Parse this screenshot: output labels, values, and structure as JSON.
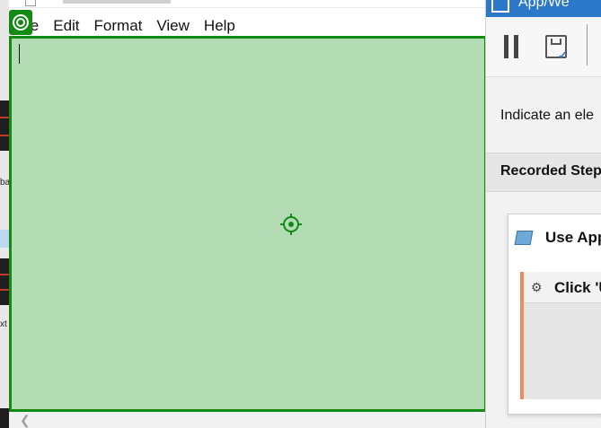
{
  "notepad": {
    "menu": [
      "le",
      "Edit",
      "Format",
      "View",
      "Help"
    ]
  },
  "recorder": {
    "title": "App/We",
    "indicate_text": "Indicate an ele",
    "recorded_steps_label": "Recorded Step",
    "card_title": "Use App",
    "step_label": "Click 'U"
  },
  "background": {
    "left_text_1": "ba",
    "left_text_2": "xt"
  },
  "colors": {
    "highlight_border": "#138a13",
    "highlight_fill": "#b4dcb4",
    "accent_blue": "#2b78c9",
    "step_accent": "#f28a5a"
  }
}
